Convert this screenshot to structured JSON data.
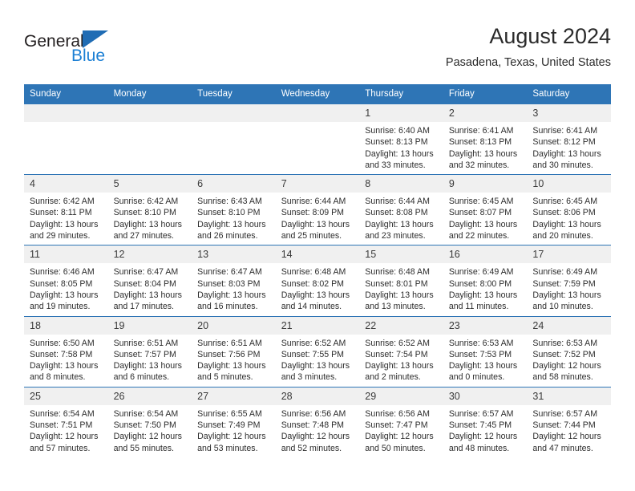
{
  "brand": {
    "name_part1": "General",
    "name_part2": "Blue",
    "triangle_color": "#1f6cb4",
    "blue_color": "#1b7fd4"
  },
  "header": {
    "title": "August 2024",
    "subtitle": "Pasadena, Texas, United States"
  },
  "theme": {
    "header_bg": "#2e75b6",
    "daynum_bg": "#f0f0f0",
    "cell_bg": "#ffffff",
    "text": "#2d2d2d"
  },
  "weekday_headers": [
    "Sunday",
    "Monday",
    "Tuesday",
    "Wednesday",
    "Thursday",
    "Friday",
    "Saturday"
  ],
  "labels": {
    "sunrise_prefix": "Sunrise:",
    "sunset_prefix": "Sunset:",
    "daylight_prefix": "Daylight:"
  },
  "weeks": [
    [
      {
        "day": "",
        "line1": "",
        "line2": "",
        "line3": "",
        "line4": ""
      },
      {
        "day": "",
        "line1": "",
        "line2": "",
        "line3": "",
        "line4": ""
      },
      {
        "day": "",
        "line1": "",
        "line2": "",
        "line3": "",
        "line4": ""
      },
      {
        "day": "",
        "line1": "",
        "line2": "",
        "line3": "",
        "line4": ""
      },
      {
        "day": "1",
        "line1": "Sunrise: 6:40 AM",
        "line2": "Sunset: 8:13 PM",
        "line3": "Daylight: 13 hours",
        "line4": "and 33 minutes."
      },
      {
        "day": "2",
        "line1": "Sunrise: 6:41 AM",
        "line2": "Sunset: 8:13 PM",
        "line3": "Daylight: 13 hours",
        "line4": "and 32 minutes."
      },
      {
        "day": "3",
        "line1": "Sunrise: 6:41 AM",
        "line2": "Sunset: 8:12 PM",
        "line3": "Daylight: 13 hours",
        "line4": "and 30 minutes."
      }
    ],
    [
      {
        "day": "4",
        "line1": "Sunrise: 6:42 AM",
        "line2": "Sunset: 8:11 PM",
        "line3": "Daylight: 13 hours",
        "line4": "and 29 minutes."
      },
      {
        "day": "5",
        "line1": "Sunrise: 6:42 AM",
        "line2": "Sunset: 8:10 PM",
        "line3": "Daylight: 13 hours",
        "line4": "and 27 minutes."
      },
      {
        "day": "6",
        "line1": "Sunrise: 6:43 AM",
        "line2": "Sunset: 8:10 PM",
        "line3": "Daylight: 13 hours",
        "line4": "and 26 minutes."
      },
      {
        "day": "7",
        "line1": "Sunrise: 6:44 AM",
        "line2": "Sunset: 8:09 PM",
        "line3": "Daylight: 13 hours",
        "line4": "and 25 minutes."
      },
      {
        "day": "8",
        "line1": "Sunrise: 6:44 AM",
        "line2": "Sunset: 8:08 PM",
        "line3": "Daylight: 13 hours",
        "line4": "and 23 minutes."
      },
      {
        "day": "9",
        "line1": "Sunrise: 6:45 AM",
        "line2": "Sunset: 8:07 PM",
        "line3": "Daylight: 13 hours",
        "line4": "and 22 minutes."
      },
      {
        "day": "10",
        "line1": "Sunrise: 6:45 AM",
        "line2": "Sunset: 8:06 PM",
        "line3": "Daylight: 13 hours",
        "line4": "and 20 minutes."
      }
    ],
    [
      {
        "day": "11",
        "line1": "Sunrise: 6:46 AM",
        "line2": "Sunset: 8:05 PM",
        "line3": "Daylight: 13 hours",
        "line4": "and 19 minutes."
      },
      {
        "day": "12",
        "line1": "Sunrise: 6:47 AM",
        "line2": "Sunset: 8:04 PM",
        "line3": "Daylight: 13 hours",
        "line4": "and 17 minutes."
      },
      {
        "day": "13",
        "line1": "Sunrise: 6:47 AM",
        "line2": "Sunset: 8:03 PM",
        "line3": "Daylight: 13 hours",
        "line4": "and 16 minutes."
      },
      {
        "day": "14",
        "line1": "Sunrise: 6:48 AM",
        "line2": "Sunset: 8:02 PM",
        "line3": "Daylight: 13 hours",
        "line4": "and 14 minutes."
      },
      {
        "day": "15",
        "line1": "Sunrise: 6:48 AM",
        "line2": "Sunset: 8:01 PM",
        "line3": "Daylight: 13 hours",
        "line4": "and 13 minutes."
      },
      {
        "day": "16",
        "line1": "Sunrise: 6:49 AM",
        "line2": "Sunset: 8:00 PM",
        "line3": "Daylight: 13 hours",
        "line4": "and 11 minutes."
      },
      {
        "day": "17",
        "line1": "Sunrise: 6:49 AM",
        "line2": "Sunset: 7:59 PM",
        "line3": "Daylight: 13 hours",
        "line4": "and 10 minutes."
      }
    ],
    [
      {
        "day": "18",
        "line1": "Sunrise: 6:50 AM",
        "line2": "Sunset: 7:58 PM",
        "line3": "Daylight: 13 hours",
        "line4": "and 8 minutes."
      },
      {
        "day": "19",
        "line1": "Sunrise: 6:51 AM",
        "line2": "Sunset: 7:57 PM",
        "line3": "Daylight: 13 hours",
        "line4": "and 6 minutes."
      },
      {
        "day": "20",
        "line1": "Sunrise: 6:51 AM",
        "line2": "Sunset: 7:56 PM",
        "line3": "Daylight: 13 hours",
        "line4": "and 5 minutes."
      },
      {
        "day": "21",
        "line1": "Sunrise: 6:52 AM",
        "line2": "Sunset: 7:55 PM",
        "line3": "Daylight: 13 hours",
        "line4": "and 3 minutes."
      },
      {
        "day": "22",
        "line1": "Sunrise: 6:52 AM",
        "line2": "Sunset: 7:54 PM",
        "line3": "Daylight: 13 hours",
        "line4": "and 2 minutes."
      },
      {
        "day": "23",
        "line1": "Sunrise: 6:53 AM",
        "line2": "Sunset: 7:53 PM",
        "line3": "Daylight: 13 hours",
        "line4": "and 0 minutes."
      },
      {
        "day": "24",
        "line1": "Sunrise: 6:53 AM",
        "line2": "Sunset: 7:52 PM",
        "line3": "Daylight: 12 hours",
        "line4": "and 58 minutes."
      }
    ],
    [
      {
        "day": "25",
        "line1": "Sunrise: 6:54 AM",
        "line2": "Sunset: 7:51 PM",
        "line3": "Daylight: 12 hours",
        "line4": "and 57 minutes."
      },
      {
        "day": "26",
        "line1": "Sunrise: 6:54 AM",
        "line2": "Sunset: 7:50 PM",
        "line3": "Daylight: 12 hours",
        "line4": "and 55 minutes."
      },
      {
        "day": "27",
        "line1": "Sunrise: 6:55 AM",
        "line2": "Sunset: 7:49 PM",
        "line3": "Daylight: 12 hours",
        "line4": "and 53 minutes."
      },
      {
        "day": "28",
        "line1": "Sunrise: 6:56 AM",
        "line2": "Sunset: 7:48 PM",
        "line3": "Daylight: 12 hours",
        "line4": "and 52 minutes."
      },
      {
        "day": "29",
        "line1": "Sunrise: 6:56 AM",
        "line2": "Sunset: 7:47 PM",
        "line3": "Daylight: 12 hours",
        "line4": "and 50 minutes."
      },
      {
        "day": "30",
        "line1": "Sunrise: 6:57 AM",
        "line2": "Sunset: 7:45 PM",
        "line3": "Daylight: 12 hours",
        "line4": "and 48 minutes."
      },
      {
        "day": "31",
        "line1": "Sunrise: 6:57 AM",
        "line2": "Sunset: 7:44 PM",
        "line3": "Daylight: 12 hours",
        "line4": "and 47 minutes."
      }
    ]
  ]
}
